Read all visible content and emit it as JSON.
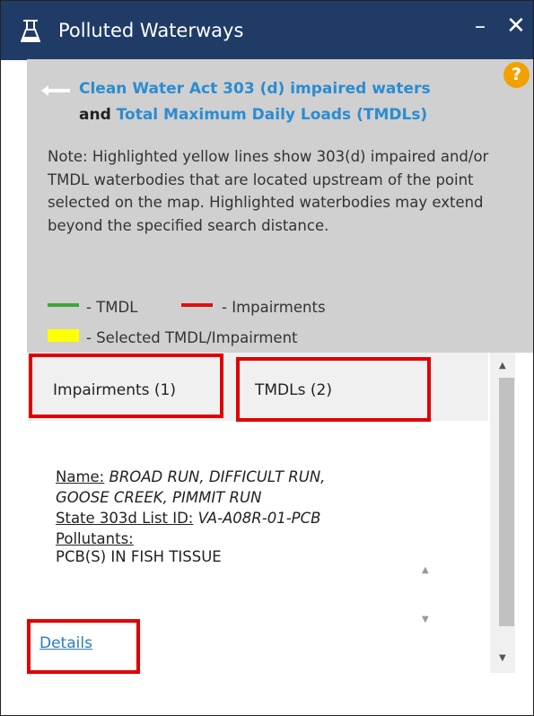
{
  "window": {
    "title": "Polluted Waterways",
    "minimize_glyph": "–",
    "close_glyph": "✕"
  },
  "header": {
    "link1": "Clean Water Act 303 (d) impaired waters",
    "and": "and",
    "link2": "Total Maximum Daily Loads (TMDLs)",
    "help_glyph": "?"
  },
  "note": "Note: Highlighted yellow lines show 303(d) impaired and/or TMDL waterbodies that are located upstream of the point selected on the map. Highlighted waterbodies may extend beyond the specified search distance.",
  "legend": {
    "tmdl": "- TMDL",
    "impairments": "- Impairments",
    "selected": "- Selected TMDL/Impairment",
    "colors": {
      "tmdl": "#3aa935",
      "impairments": "#e01010",
      "selected": "#ffff00"
    }
  },
  "tabs": [
    {
      "label": "Impairments (1)"
    },
    {
      "label": "TMDLs (2)"
    }
  ],
  "record": {
    "name_label": "Name:",
    "name_value_1": "BROAD RUN, DIFFICULT RUN,",
    "name_value_2": "GOOSE CREEK, PIMMIT RUN",
    "list_id_label": "State 303d List ID:",
    "list_id_value": "VA-A08R-01-PCB",
    "pollutants_label": "Pollutants:",
    "pollutants": [
      "PCB(S) IN FISH TISSUE"
    ]
  },
  "details_link": "Details",
  "colors": {
    "titlebar": "#1f3b66",
    "link": "#2b8cd2",
    "highlight": "#e00000",
    "help": "#f2a100"
  }
}
